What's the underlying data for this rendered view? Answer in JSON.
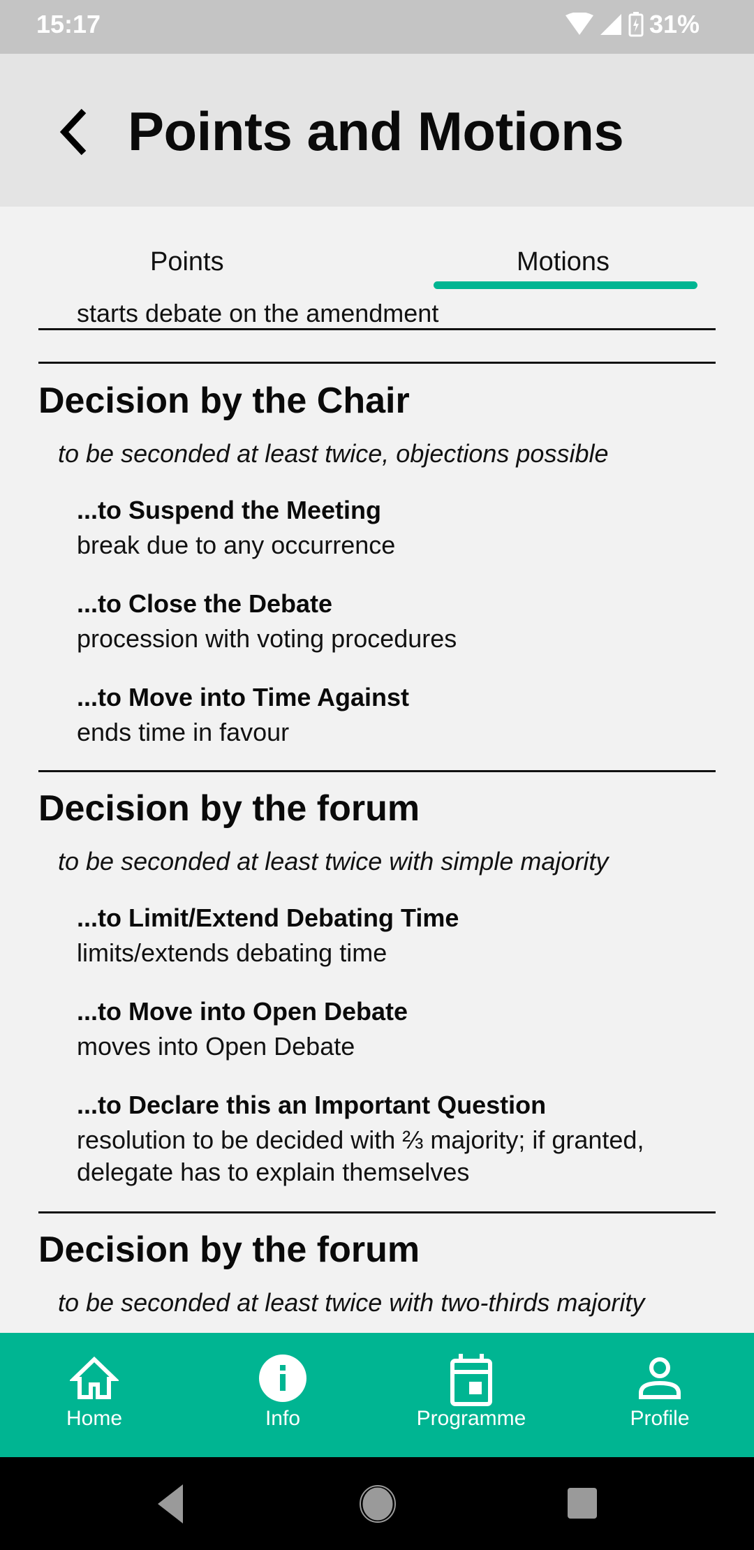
{
  "status_bar": {
    "time": "15:17",
    "battery": "31%"
  },
  "app_bar": {
    "title": "Points and Motions"
  },
  "tabs": [
    {
      "label": "Points",
      "active": false
    },
    {
      "label": "Motions",
      "active": true
    }
  ],
  "content": {
    "cutoff_text": "starts debate on the amendment",
    "sections": [
      {
        "heading": "Decision by the Chair",
        "subtitle": "to be seconded at least twice, objections possible",
        "items": [
          {
            "title": "...to Suspend the Meeting",
            "desc": "break due to any occurrence"
          },
          {
            "title": "...to Close the Debate",
            "desc": "procession with voting procedures"
          },
          {
            "title": "...to Move into Time Against",
            "desc": "ends time in favour"
          }
        ]
      },
      {
        "heading": "Decision by the forum",
        "subtitle": "to be seconded at least twice with simple majority",
        "items": [
          {
            "title": "...to Limit/Extend Debating Time",
            "desc": "limits/extends debating time"
          },
          {
            "title": "...to Move into Open Debate",
            "desc": "moves into Open Debate"
          },
          {
            "title": "...to Declare this an Important Question",
            "desc": "resolution to be decided with ⅔ majority; if granted, delegate has to explain themselves"
          }
        ]
      },
      {
        "heading": "Decision by the forum",
        "subtitle": "to be seconded at least twice with two-thirds majority",
        "items": []
      }
    ]
  },
  "bottom_nav": [
    {
      "label": "Home",
      "icon": "home-icon"
    },
    {
      "label": "Info",
      "icon": "info-icon"
    },
    {
      "label": "Programme",
      "icon": "calendar-icon"
    },
    {
      "label": "Profile",
      "icon": "person-icon"
    }
  ],
  "colors": {
    "accent": "#00b592",
    "app_bar": "#e4e4e4",
    "status_bar": "#c4c4c4",
    "background": "#f2f2f2"
  }
}
